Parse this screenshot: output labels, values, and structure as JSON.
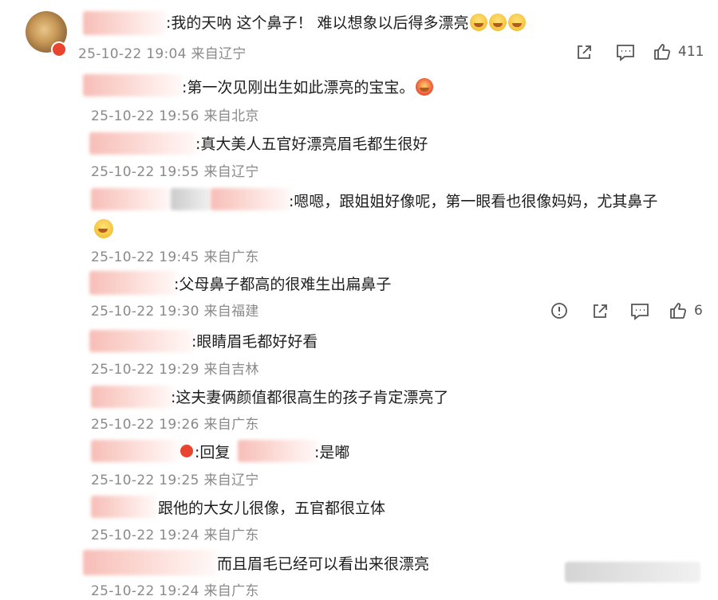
{
  "main_comment": {
    "text": ":我的天呐  这个鼻子！  难以想象以后得多漂亮",
    "time": "25-10-22 19:04",
    "location": "来自辽宁",
    "like_count": "411"
  },
  "replies": [
    {
      "text": ":第一次见刚出生如此漂亮的宝宝。",
      "time": "25-10-22 19:56",
      "location": "来自北京"
    },
    {
      "text": ":真大美人五官好漂亮眉毛都生很好",
      "time": "25-10-22 19:55",
      "location": "来自辽宁"
    },
    {
      "text": ":嗯嗯，跟姐姐好像呢，第一眼看也很像妈妈，尤其鼻子",
      "time": "25-10-22 19:45",
      "location": "来自广东"
    },
    {
      "text": ":父母鼻子都高的很难生出扁鼻子",
      "time": "25-10-22 19:30",
      "location": "来自福建",
      "like_count": "6"
    },
    {
      "text": ":眼睛眉毛都好好看",
      "time": "25-10-22 19:29",
      "location": "来自吉林"
    },
    {
      "text": ":这夫妻俩颜值都很高生的孩子肯定漂亮了",
      "time": "25-10-22 19:26",
      "location": "来自广东"
    },
    {
      "prefix": ":回复",
      "text": ":是嘟",
      "time": "25-10-22 19:25",
      "location": "来自辽宁"
    },
    {
      "text": "跟他的大女儿很像，五官都很立体",
      "time": "25-10-22 19:24",
      "location": "来自广东"
    },
    {
      "text": "而且眉毛已经可以看出来很漂亮",
      "time": "25-10-22 19:24",
      "location": "来自广东"
    }
  ],
  "icons": {
    "share": "share-icon",
    "comment": "comment-icon",
    "like": "like-icon",
    "report": "report-icon"
  },
  "colors": {
    "text": "#1e1e1e",
    "meta": "#8a8a8a",
    "badge": "#e8442f"
  }
}
